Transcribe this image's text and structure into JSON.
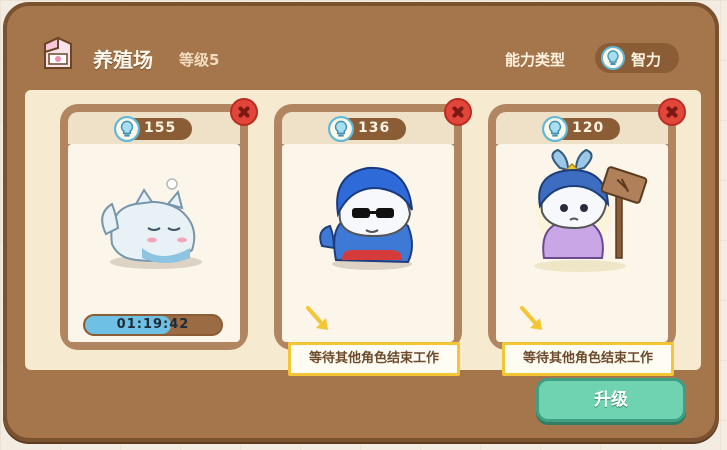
{
  "header": {
    "title": "养殖场",
    "level": "等级5",
    "ability_label": "能力类型",
    "ability_value": "智力"
  },
  "cards": [
    {
      "value": "155",
      "timer": "01:19:42",
      "timer_progress": 0.63,
      "status": ""
    },
    {
      "value": "136",
      "status": "等待其他角色结束工作"
    },
    {
      "value": "120",
      "status": "等待其他角色结束工作"
    }
  ],
  "footer": {
    "upgrade_label": "升级"
  },
  "colors": {
    "panel": "#a5754b",
    "accent_green": "#6fd3b1",
    "close_red": "#e2463a",
    "highlight_yellow": "#f4c535"
  },
  "icons": [
    "milk-carton-icon",
    "lightbulb-icon",
    "close-icon",
    "arrow-icon"
  ]
}
